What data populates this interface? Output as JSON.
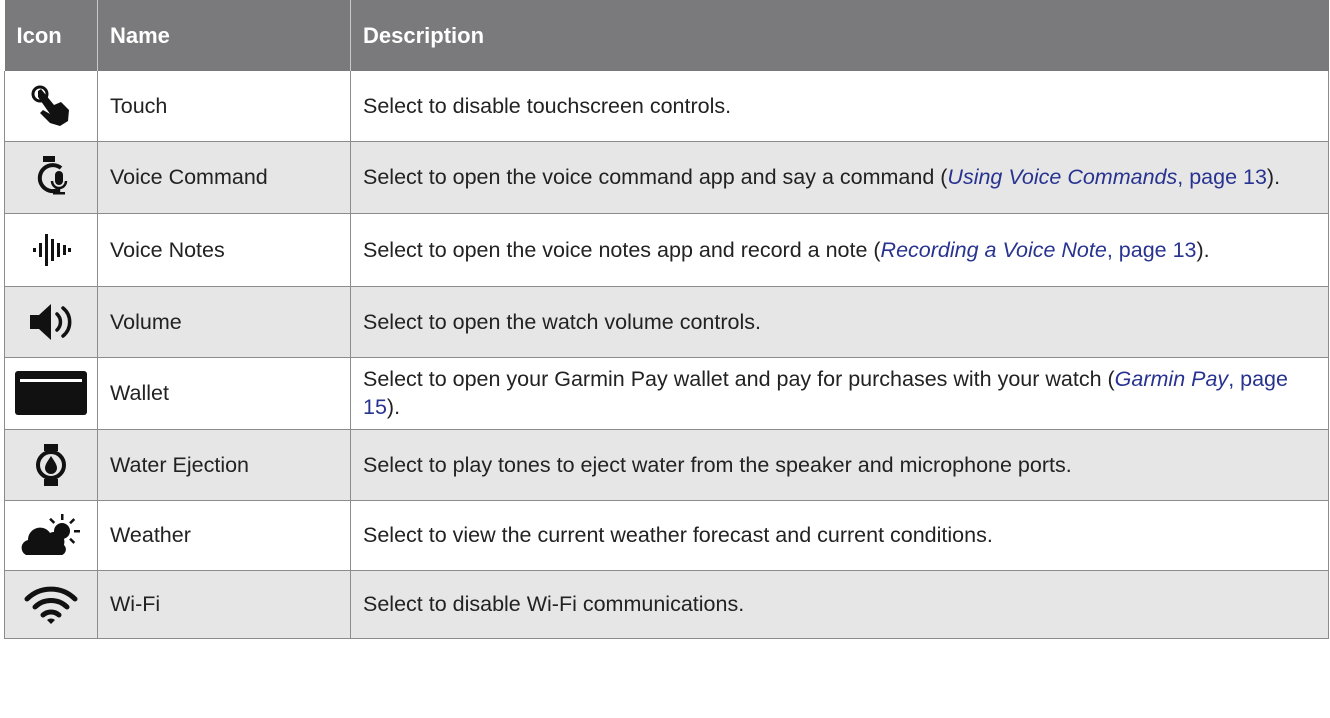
{
  "headers": {
    "icon": "Icon",
    "name": "Name",
    "description": "Description"
  },
  "rows": [
    {
      "icon": "touch-icon",
      "name": "Touch",
      "desc_plain": "Select to disable touchscreen controls."
    },
    {
      "icon": "voice-command-icon",
      "name": "Voice Command",
      "desc_pre": "Select to open the voice command app and say a command (",
      "link": "Using Voice Commands",
      "page": ", page 13",
      "desc_post": ")."
    },
    {
      "icon": "voice-notes-icon",
      "name": "Voice Notes",
      "desc_pre": "Select to open the voice notes app and record a note (",
      "link": "Recording a Voice Note",
      "page": ", page 13",
      "desc_post": ")."
    },
    {
      "icon": "volume-icon",
      "name": "Volume",
      "desc_plain": "Select to open the watch volume controls."
    },
    {
      "icon": "wallet-icon",
      "name": "Wallet",
      "desc_pre": "Select to open your Garmin Pay wallet and pay for purchases with your watch (",
      "link": "Garmin Pay",
      "page": ", page 15",
      "desc_post": ")."
    },
    {
      "icon": "water-ejection-icon",
      "name": "Water Ejection",
      "desc_plain": "Select to play tones to eject water from the speaker and microphone ports."
    },
    {
      "icon": "weather-icon",
      "name": "Weather",
      "desc_plain": "Select to view the current weather forecast and current conditions."
    },
    {
      "icon": "wifi-icon",
      "name": "Wi-Fi",
      "desc_plain": "Select to disable Wi-Fi communications."
    }
  ]
}
